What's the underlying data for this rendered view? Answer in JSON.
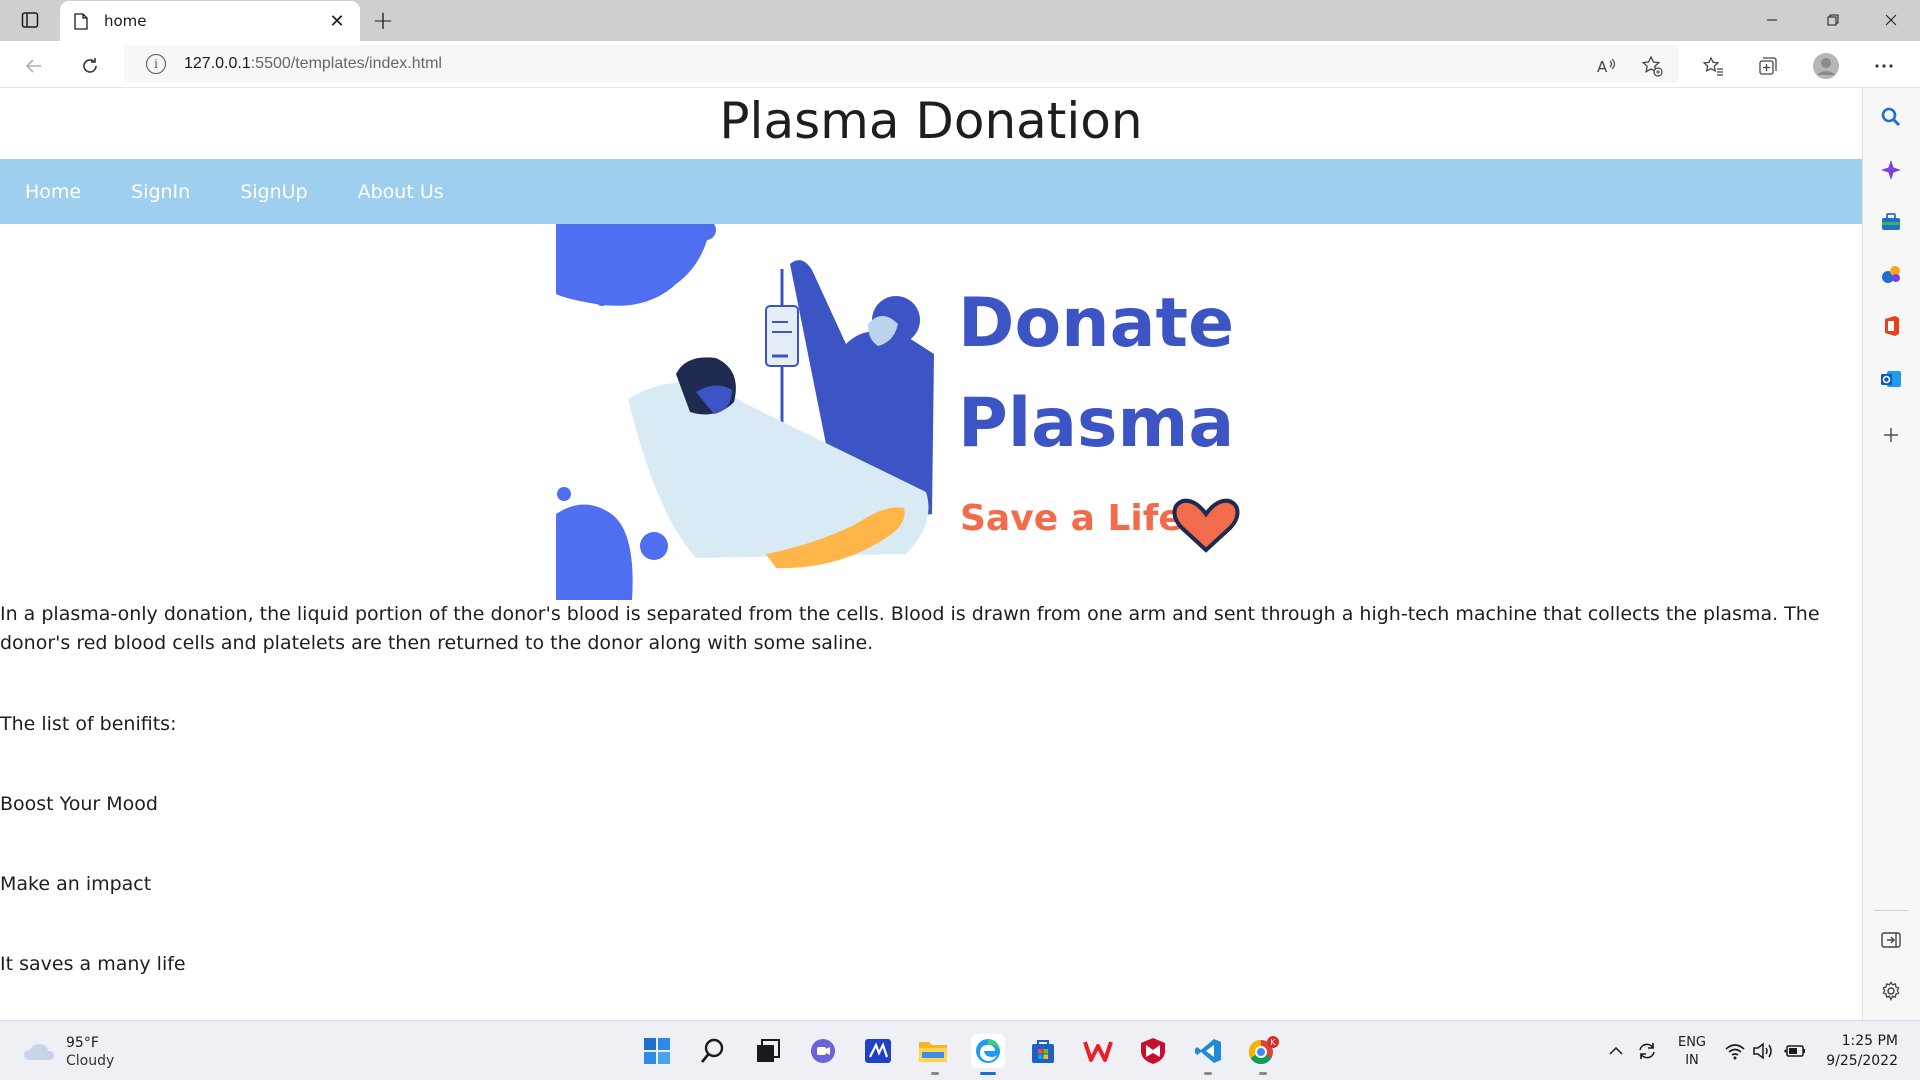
{
  "browser": {
    "tab_title": "home",
    "tab_close": "✕",
    "new_tab": "+",
    "url_host": "127.0.0.1",
    "url_rest": ":5500/templates/index.html"
  },
  "page": {
    "heading": "Plasma Donation",
    "nav": [
      "Home",
      "SignIn",
      "SignUp",
      "About Us"
    ],
    "hero": {
      "line1": "Donate",
      "line2": "Plasma",
      "line3": "Save a Life"
    },
    "intro": "In a plasma-only donation, the liquid portion of the donor's blood is separated from the cells. Blood is drawn from one arm and sent through a high-tech machine that collects the plasma. The donor's red blood cells and platelets are then returned to the donor along with some saline.",
    "benefits_title": "The list of benifits:",
    "benefits": [
      "Boost Your Mood",
      "Make an impact",
      "It saves a many life"
    ]
  },
  "taskbar": {
    "weather_temp": "95°F",
    "weather_cond": "Cloudy",
    "lang_line1": "ENG",
    "lang_line2": "IN",
    "time": "1:25 PM",
    "date": "9/25/2022"
  },
  "colors": {
    "nav_bg": "#9ecfee",
    "hero_blue": "#3d55c4",
    "hero_orange": "#f26b4b"
  }
}
